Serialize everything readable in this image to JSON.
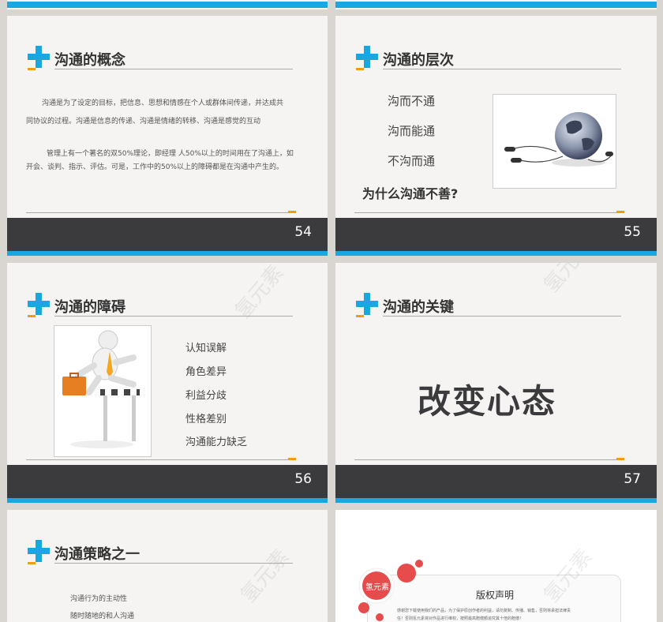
{
  "slides": {
    "s54": {
      "title": "沟通的概念",
      "para1a": "沟通是为了设定的目标，把信息、思想和情感在个人或群体间传递，并达成共",
      "para1b": "同协议的过程。沟通是信息的传递、沟通是情绪的转移、沟通是感觉的互动",
      "para2a": "管理上有一个著名的双50%理论，即经理 人50%以上的时间用在了沟通上，如",
      "para2b": "开会、谈判、指示、评估。可是，工作中的50%以上的障碍都是在沟通中产生的。",
      "number": "54"
    },
    "s55": {
      "title": "沟通的层次",
      "items": [
        "沟而不通",
        "沟而能通",
        "不沟而通"
      ],
      "question": "为什么沟通不善?",
      "number": "55"
    },
    "s56": {
      "title": "沟通的障碍",
      "items": [
        "认知误解",
        "角色差异",
        "利益分歧",
        "性格差别",
        "沟通能力缺乏"
      ],
      "number": "56"
    },
    "s57": {
      "title": "沟通的关键",
      "big_text": "改变心态",
      "number": "57"
    },
    "s58": {
      "title": "沟通策略之一",
      "items": [
        "沟通行为的主动性",
        "随时随地的和人沟通"
      ]
    },
    "s59": {
      "badge": "氢元素",
      "heading": "版权声明",
      "line1": "感谢您下载使用我们的产品，为了保护原创作者的利益，请勿复制、传播、销售，否则将承担法律责",
      "line2": "任！否则氢元素将对作品进行维权，按照最高赔偿额追究其十倍的赔偿！"
    },
    "watermark": "氢元素"
  }
}
